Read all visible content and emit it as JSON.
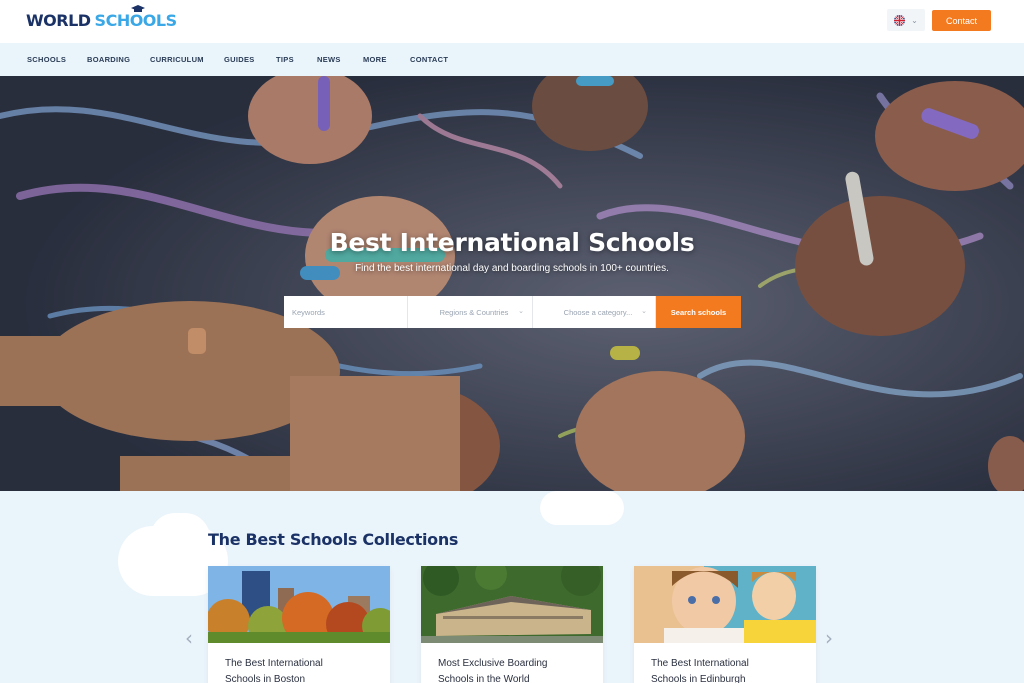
{
  "brand": {
    "word1": "WORLD",
    "word2": "SCHOOLS"
  },
  "header": {
    "contact_label": "Contact",
    "language": "gb-flag-icon"
  },
  "nav": {
    "items": [
      {
        "label": "SCHOOLS"
      },
      {
        "label": "BOARDING"
      },
      {
        "label": "CURRICULUM"
      },
      {
        "label": "GUIDES"
      },
      {
        "label": "TIPS"
      },
      {
        "label": "NEWS"
      },
      {
        "label": "MORE"
      },
      {
        "label": "CONTACT"
      }
    ]
  },
  "hero": {
    "title": "Best International Schools",
    "subtitle": "Find the best international day and boarding schools in 100+ countries."
  },
  "search": {
    "keywords_placeholder": "Keywords",
    "region_label": "Regions & Countries",
    "category_label": "Choose a category...",
    "button_label": "Search schools"
  },
  "collections": {
    "title": "The Best Schools Collections",
    "cards": [
      {
        "line1": "The Best International",
        "line2": "Schools in Boston"
      },
      {
        "line1": "Most Exclusive Boarding",
        "line2": "Schools in the World"
      },
      {
        "line1": "The Best International",
        "line2": "Schools in Edinburgh"
      }
    ]
  },
  "colors": {
    "accent": "#f47a20",
    "navy": "#1b3266",
    "sky": "#3aa7e6",
    "light_bg": "#eaf4fb"
  }
}
